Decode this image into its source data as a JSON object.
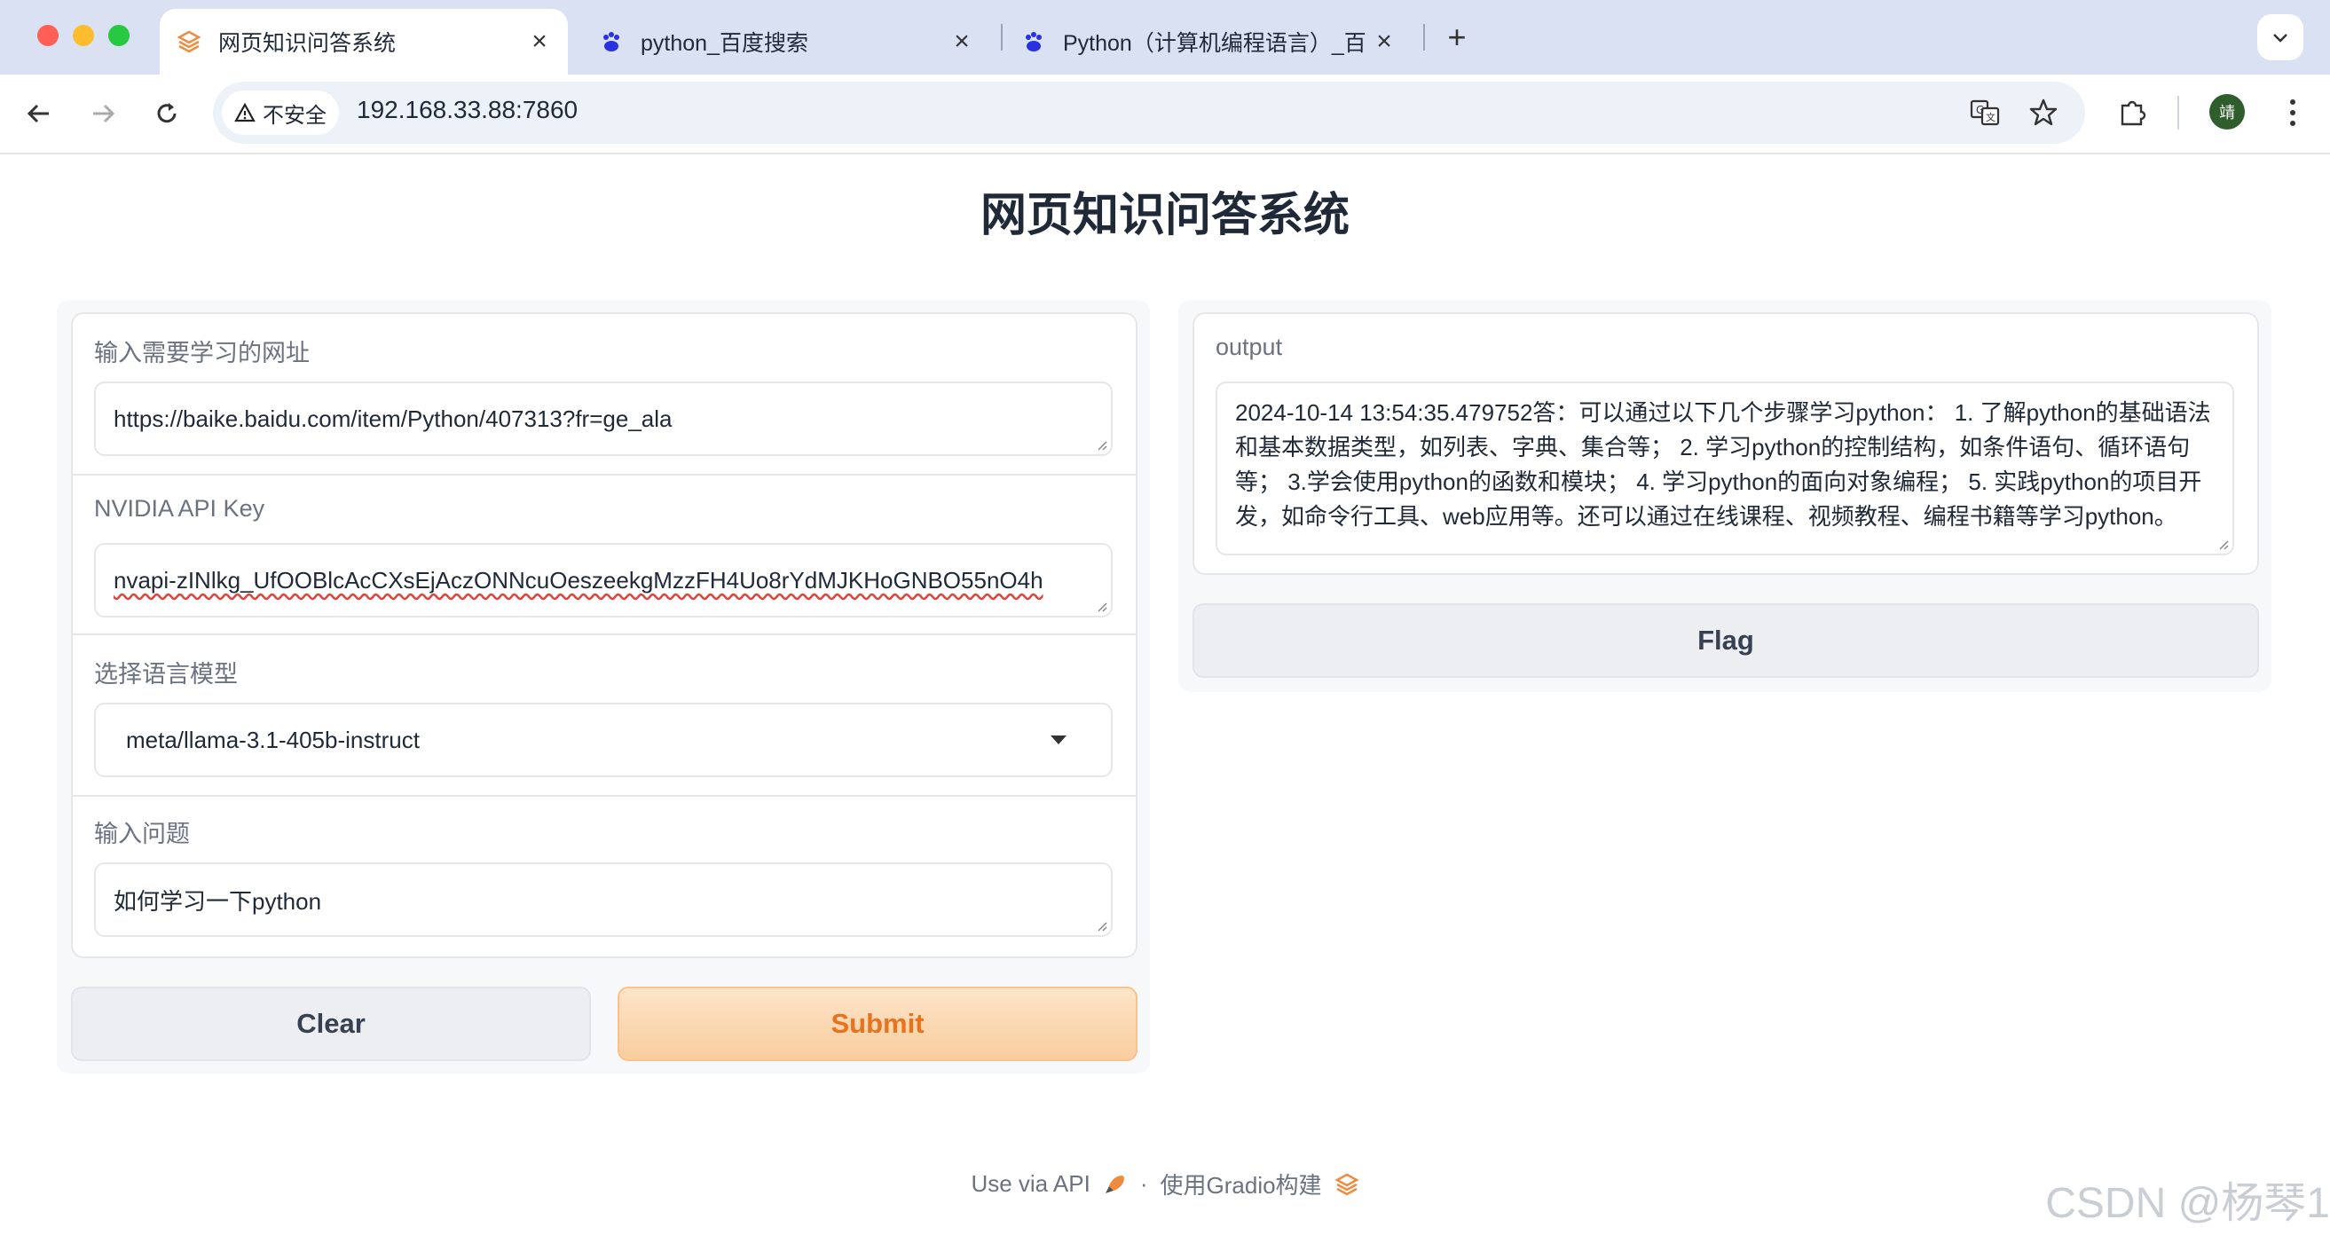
{
  "browser": {
    "tabs": [
      {
        "title": "网页知识问答系统",
        "favicon": "gradio-icon"
      },
      {
        "title": "python_百度搜索",
        "favicon": "baidu-paw-icon"
      },
      {
        "title": "Python（计算机编程语言）_百",
        "favicon": "baidu-paw-icon"
      }
    ],
    "new_tab_label": "+",
    "security_label": "不安全",
    "address": "192.168.33.88:7860",
    "profile_initial": "靖"
  },
  "page": {
    "title": "网页知识问答系统",
    "inputs": {
      "url_label": "输入需要学习的网址",
      "url_value": "https://baike.baidu.com/item/Python/407313?fr=ge_ala",
      "api_key_label": "NVIDIA API Key",
      "api_key_value": "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",
      "model_label": "选择语言模型",
      "model_value": "meta/llama-3.1-405b-instruct",
      "question_label": "输入问题",
      "question_value": "如何学习一下python"
    },
    "buttons": {
      "clear": "Clear",
      "submit": "Submit",
      "flag": "Flag"
    },
    "output": {
      "label": "output",
      "text": "2024-10-14 13:54:35.479752答：可以通过以下几个步骤学习python： 1. 了解python的基础语法和基本数据类型，如列表、字典、集合等； 2. 学习python的控制结构，如条件语句、循环语句等； 3.学会使用python的函数和模块； 4. 学习python的面向对象编程； 5. 实践python的项目开发，如命令行工具、web应用等。还可以通过在线课程、视频教程、编程书籍等学习python。"
    },
    "footer": {
      "api": "Use via API",
      "separator": "·",
      "built_with": "使用Gradio构建"
    }
  },
  "watermark": "CSDN @杨琴1",
  "colors": {
    "accent": "#f08a3c",
    "submit_bg": "#fbd7b1",
    "tabbar": "#d9e1f2"
  }
}
